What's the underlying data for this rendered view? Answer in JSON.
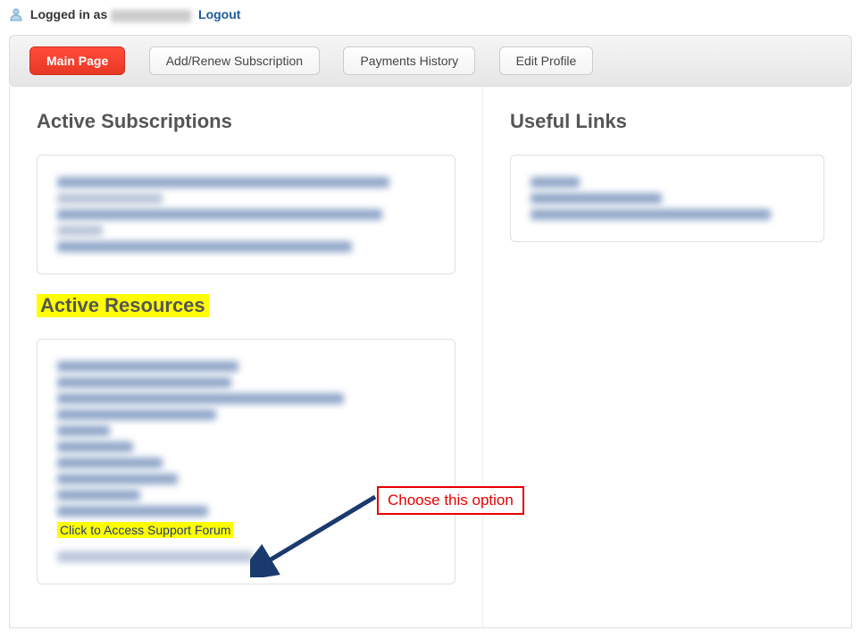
{
  "header": {
    "logged_in_label": "Logged in as",
    "logout_label": "Logout"
  },
  "tabs": {
    "main": "Main Page",
    "add_renew": "Add/Renew Subscription",
    "payments": "Payments History",
    "edit_profile": "Edit Profile"
  },
  "left": {
    "subs_title": "Active Subscriptions",
    "resources_title": "Active Resources",
    "support_link": "Click to Access Support Forum"
  },
  "right": {
    "links_title": "Useful Links"
  },
  "annotation": {
    "text": "Choose this option"
  }
}
